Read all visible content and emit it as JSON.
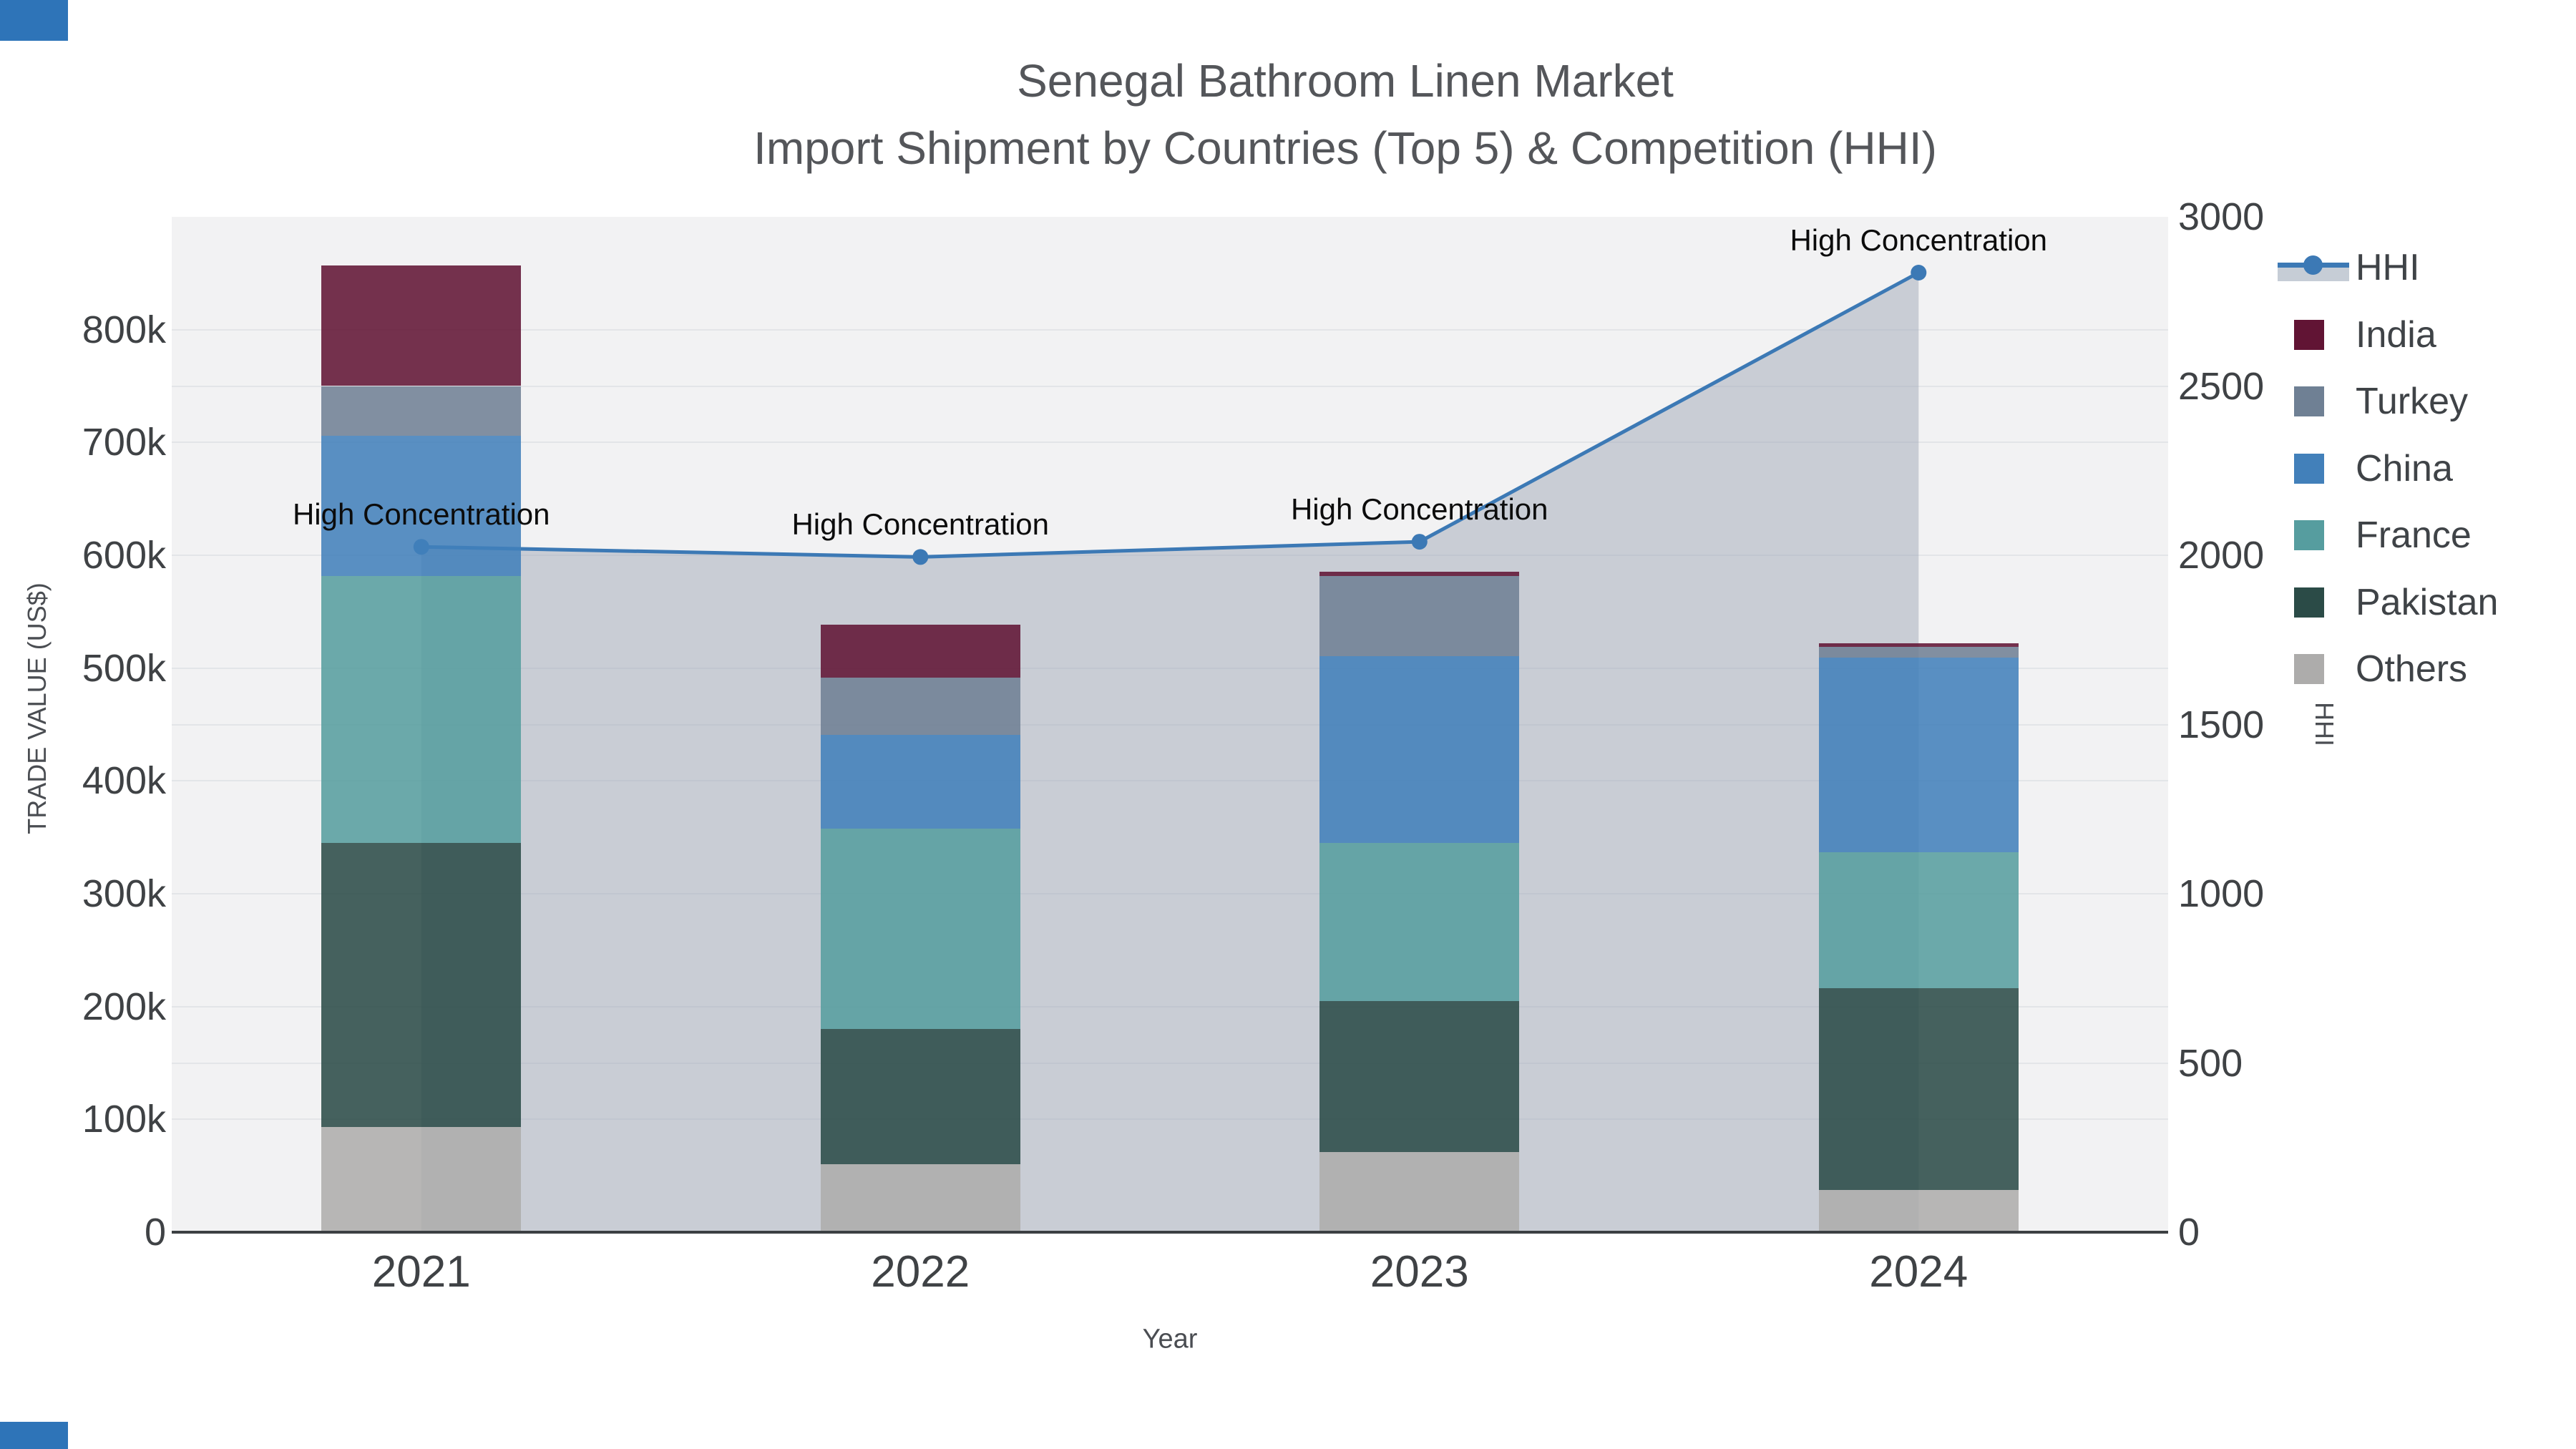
{
  "title": {
    "line1": "Senegal Bathroom Linen Market",
    "line2": "Import Shipment by Countries (Top 5) & Competition (HHI)"
  },
  "x_axis": {
    "title": "Year",
    "ticks": [
      "2021",
      "2022",
      "2023",
      "2024"
    ]
  },
  "y_left": {
    "title": "TRADE VALUE (US$)",
    "ticks": [
      "0",
      "100k",
      "200k",
      "300k",
      "400k",
      "500k",
      "600k",
      "700k",
      "800k"
    ]
  },
  "y_right": {
    "title": "HHI",
    "ticks": [
      "0",
      "500",
      "1000",
      "1500",
      "2000",
      "2500",
      "3000"
    ]
  },
  "annotation_label": "High Concentration",
  "legend": [
    {
      "label": "HHI",
      "color": "#3c79b5",
      "type": "line"
    },
    {
      "label": "India",
      "color": "#611434",
      "type": "square"
    },
    {
      "label": "Turkey",
      "color": "#6f8094",
      "type": "square"
    },
    {
      "label": "China",
      "color": "#4280ba",
      "type": "square"
    },
    {
      "label": "France",
      "color": "#569d9f",
      "type": "square"
    },
    {
      "label": "Pakistan",
      "color": "#2b4b47",
      "type": "square"
    },
    {
      "label": "Others",
      "color": "#adacab",
      "type": "square"
    }
  ],
  "colors": {
    "plot_bg": "#f2f2f3",
    "grid": "#e3e5e8",
    "axis_line": "#3c4043",
    "hhi_line": "#3c79b5",
    "hhi_fill": "rgba(160,168,183,0.5)",
    "corner_accent": "#2e74b8"
  },
  "chart_data": {
    "type": "combo_stacked_bar_plus_line_area",
    "categories": [
      "2021",
      "2022",
      "2023",
      "2024"
    ],
    "bar_unit": "US$",
    "stack_order_bottom_to_top": [
      "Others",
      "Pakistan",
      "France",
      "China",
      "Turkey",
      "India"
    ],
    "series": [
      {
        "name": "Others",
        "color": "#adacab",
        "values": [
          93000,
          60000,
          71000,
          37500
        ]
      },
      {
        "name": "Pakistan",
        "color": "#2b4b47",
        "values": [
          252000,
          120000,
          134000,
          178500
        ]
      },
      {
        "name": "France",
        "color": "#569d9f",
        "values": [
          236500,
          177500,
          140000,
          121000
        ]
      },
      {
        "name": "China",
        "color": "#4280ba",
        "values": [
          124500,
          83500,
          165500,
          172000
        ]
      },
      {
        "name": "Turkey",
        "color": "#6f8094",
        "values": [
          44000,
          50500,
          71000,
          9500
        ]
      },
      {
        "name": "India",
        "color": "#611434",
        "values": [
          107000,
          47000,
          4000,
          3500
        ]
      }
    ],
    "bar_totals": [
      857000,
      538500,
      585500,
      522000
    ],
    "hhi_series": {
      "name": "HHI",
      "axis": "right",
      "values": [
        2025,
        1995,
        2040,
        2835
      ]
    },
    "annotations": [
      "High Concentration",
      "High Concentration",
      "High Concentration",
      "High Concentration"
    ],
    "ylim_left": [
      0,
      900000
    ],
    "ylim_right": [
      0,
      3000
    ],
    "xlabel": "Year",
    "ylabel_left": "TRADE VALUE (US$)",
    "ylabel_right": "HHI",
    "grid": true,
    "legend_position": "right"
  }
}
